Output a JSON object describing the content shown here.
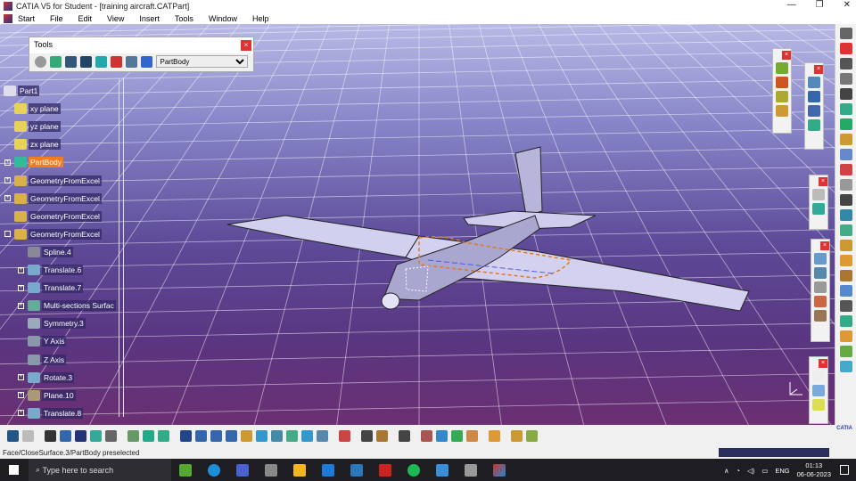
{
  "window": {
    "title": "CATIA V5 for Student - [training aircraft.CATPart]",
    "controls": [
      "—",
      "❐",
      "✕"
    ]
  },
  "menu": [
    "Start",
    "File",
    "Edit",
    "View",
    "Insert",
    "Tools",
    "Window",
    "Help"
  ],
  "tools_panel": {
    "title": "Tools",
    "close": "×",
    "current_body": "PartBody"
  },
  "tree": [
    {
      "label": "Part1",
      "depth": 0,
      "expander": ""
    },
    {
      "label": "xy plane",
      "depth": 1,
      "expander": ""
    },
    {
      "label": "yz plane",
      "depth": 1,
      "expander": ""
    },
    {
      "label": "zx plane",
      "depth": 1,
      "expander": ""
    },
    {
      "label": "PartBody",
      "depth": 1,
      "expander": "+",
      "selected": true
    },
    {
      "label": "GeometryFromExcel",
      "depth": 1,
      "expander": "+"
    },
    {
      "label": "GeometryFromExcel",
      "depth": 1,
      "expander": "+"
    },
    {
      "label": "GeometryFromExcel",
      "depth": 1,
      "expander": ""
    },
    {
      "label": "GeometryFromExcel",
      "depth": 1,
      "expander": "-"
    },
    {
      "label": "Spline.4",
      "depth": 2,
      "expander": ""
    },
    {
      "label": "Translate.6",
      "depth": 2,
      "expander": "+"
    },
    {
      "label": "Translate.7",
      "depth": 2,
      "expander": "+"
    },
    {
      "label": "Multi-sections Surfac",
      "depth": 2,
      "expander": "+"
    },
    {
      "label": "Symmetry.3",
      "depth": 2,
      "expander": ""
    },
    {
      "label": "Y Axis",
      "depth": 2,
      "expander": ""
    },
    {
      "label": "Z Axis",
      "depth": 2,
      "expander": ""
    },
    {
      "label": "Rotate.3",
      "depth": 2,
      "expander": "+"
    },
    {
      "label": "Plane.10",
      "depth": 2,
      "expander": "+"
    },
    {
      "label": "Translate.8",
      "depth": 2,
      "expander": "+"
    }
  ],
  "status": {
    "message": "Face/CloseSurface.3/PartBody preselected"
  },
  "taskbar": {
    "search_placeholder": "Type here to search",
    "lang": "ENG",
    "time": "01:13",
    "date": "06-06-2023"
  },
  "brand": "CATIA",
  "colors": {
    "selected": "#f27c1c",
    "close": "#d33333"
  }
}
